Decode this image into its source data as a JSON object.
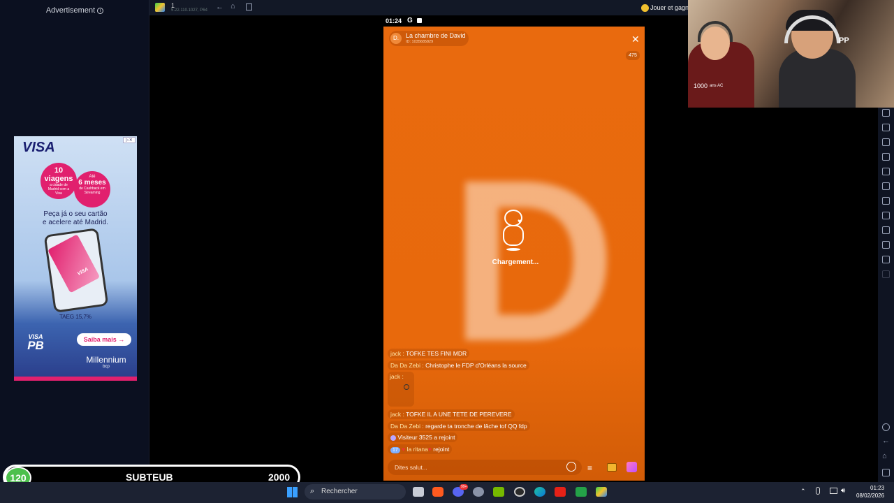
{
  "left_panel": {
    "ad_title": "Advertisement",
    "ad": {
      "brand": "VISA",
      "bubble1_num": "10",
      "bubble1_text": "viagens",
      "bubble1_small": "a cidade de Madrid com a Visa",
      "bubble2_top": "Até",
      "bubble2_text": "6 meses",
      "bubble2_small": "de Cashback em Streaming",
      "headline_line1": "Peça já o seu cartão",
      "headline_line2": "e acelere até Madrid.",
      "taeg": "TAEG 15,7%",
      "cta": "Saiba mais →",
      "partner": "Millennium",
      "partner_sub": "bcp",
      "footer_logo": "VISA",
      "footer_logo_sub": "PB",
      "card_text": "VISA"
    }
  },
  "toolbar": {
    "instance_num": "1",
    "instance_sub": "5.22.110.1027, P64",
    "promo_text": "Jouer et gagn"
  },
  "phone": {
    "time": "01:24",
    "room_avatar": "D.",
    "room_title": "La chambre de David",
    "room_id": "ID: 1035685829",
    "viewer_count": "475",
    "loading_text": "Chargement...",
    "big_letter": "D",
    "chat": [
      {
        "nick": "jack :",
        "msg": "TOFKE TES FINI MDR"
      },
      {
        "nick": "Da Da Zebi :",
        "msg": "Christophe le FDP d'Orléans la source"
      },
      {
        "nick": "jack :",
        "msg": ""
      },
      {
        "nick": "jack :",
        "msg": "TOFKE IL A UNE TETE DE PEREVERE"
      },
      {
        "nick": "Da Da Zebi :",
        "msg": "regarde ta tronche de lâche tof QQ fdp"
      }
    ],
    "join1": {
      "name": "Visiteur 3525",
      "text": "a rejoint"
    },
    "join2": {
      "level": "17",
      "name": "la ritana",
      "text": "rejoint"
    },
    "input_placeholder": "Dites salut..."
  },
  "webcam": {
    "shirt_text": "1000",
    "shirt_text2": "ans AC",
    "bg_text": "PP"
  },
  "subteub": {
    "left_value": "120",
    "label": "SUBTEUB",
    "right_value": "2000"
  },
  "taskbar": {
    "search_label": "Rechercher",
    "clock_time": "01:23",
    "clock_date": "08/02/2026",
    "discord_badge": "99+"
  }
}
